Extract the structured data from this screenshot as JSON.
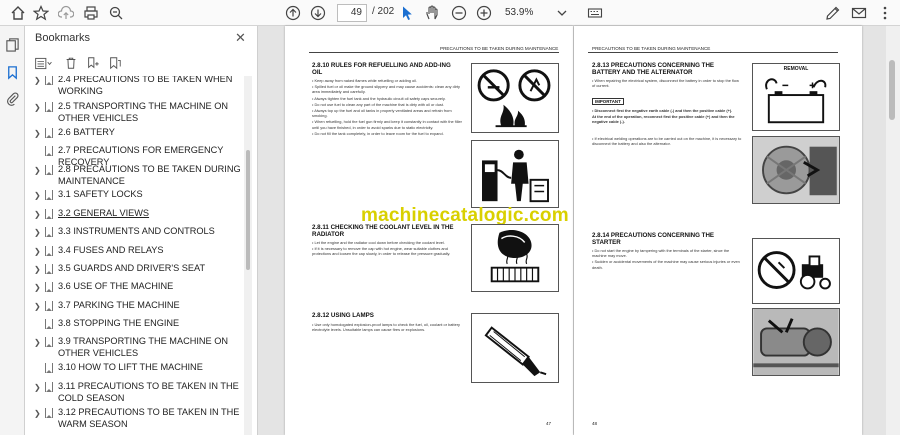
{
  "toolbar": {
    "current_page": "49",
    "total_pages": "/ 202",
    "zoom": "53.9%",
    "icons": [
      "star-icon",
      "cloud-upload-icon",
      "print-icon",
      "zoom-out-search-icon",
      "arrow-up-icon",
      "arrow-down-icon",
      "cursor-icon",
      "hand-icon",
      "minus-icon",
      "plus-icon",
      "chevron-down-icon",
      "sign-icon",
      "email-icon",
      "more-icon"
    ]
  },
  "sidebar": {
    "title": "Bookmarks",
    "close": "✕",
    "items": [
      {
        "label": "2.4 PRECAUTIONS TO BE TAKEN WHEN WORKING",
        "chevron": true
      },
      {
        "label": "2.5 TRANSPORTING THE MACHINE ON OTHER VEHICLES",
        "chevron": true
      },
      {
        "label": "2.6 BATTERY",
        "chevron": true
      },
      {
        "label": "2.7 PRECAUTIONS FOR EMERGENCY RECOVERY",
        "chevron": false
      },
      {
        "label": "2.8 PRECAUTIONS TO BE TAKEN DURING MAINTENANCE",
        "chevron": true
      },
      {
        "label": "3.1 SAFETY LOCKS",
        "chevron": true
      },
      {
        "label": "3.2 GENERAL VIEWS",
        "chevron": true,
        "underline": true
      },
      {
        "label": "3.3 INSTRUMENTS AND CONTROLS",
        "chevron": true
      },
      {
        "label": "3.4 FUSES AND RELAYS",
        "chevron": true
      },
      {
        "label": "3.5 GUARDS AND DRIVER'S SEAT",
        "chevron": true
      },
      {
        "label": "3.6 USE OF THE MACHINE",
        "chevron": true
      },
      {
        "label": "3.7 PARKING THE MACHINE",
        "chevron": true
      },
      {
        "label": "3.8 STOPPING THE ENGINE",
        "chevron": false
      },
      {
        "label": "3.9 TRANSPORTING THE MACHINE ON OTHER VEHICLES",
        "chevron": true
      },
      {
        "label": "3.10 HOW TO LIFT THE MACHINE",
        "chevron": false
      },
      {
        "label": "3.11 PRECAUTIONS TO BE TAKEN IN THE COLD SEASON",
        "chevron": true
      },
      {
        "label": "3.12 PRECAUTIONS TO BE TAKEN IN THE WARM SEASON",
        "chevron": true
      }
    ]
  },
  "doc": {
    "header_left": "PRECAUTIONS TO BE TAKEN DURING MAINTENANCE",
    "header_right": "PRECAUTIONS TO BE TAKEN DURING MAINTENANCE",
    "page_left_num": "47",
    "page_right_num": "48",
    "watermark": "machinecatalogic.com",
    "s1_title": "2.8.10 RULES FOR REFUELLING AND ADD-ING OIL",
    "s1_body": [
      "• Keep away from naked flames while refuelling or adding oil.",
      "• Spilled fuel or oil make the ground slippery and may cause accidents: clean any dirty area immediately and carefully.",
      "• Always tighten the fuel tank and the hydraulic circuit oil safety caps securely.",
      "• Do not use fuel to clean any part of the machine that is dirty with oil or dust.",
      "• Always top up the fuel and oil tanks in properly ventilated areas and refrain from smoking.",
      "• When refuelling, hold the fuel gun firmly and keep it constantly in contact with the filler until you have finished, in order to avoid sparks due to static electricity.",
      "• Do not fill the tank completely, in order to leave room for the fuel to expand."
    ],
    "s2_title": "2.8.11 CHECKING THE COOLANT LEVEL IN THE RADIATOR",
    "s2_body": [
      "• Let the engine and the radiator cool down before checking the coolant level.",
      "• If it is necessary to remove the cap with hot engine, wear suitable clothes and protections and loosen the cap slowly, in order to release the pressure gradually."
    ],
    "s3_title": "2.8.12 USING LAMPS",
    "s3_body": [
      "• Use only homologated explosion-proof lamps to check the fuel, oil, coolant or battery electrolyte levels. Unsuitable lamps can cause fires or explosions."
    ],
    "s4_title": "2.8.13 PRECAUTIONS CONCERNING THE BATTERY AND THE ALTERNATOR",
    "s4_body": [
      "• When repairing the electrical system, disconnect the battery in order to stop the flow of current."
    ],
    "important": "IMPORTANT",
    "s4_important": [
      "• Disconnect first the negative earth cable (-) and then the positive cable (+).",
      "At the end of the operation, reconnect first the positive cable (+) and then the negative cable (-)."
    ],
    "s4_body2": [
      "• If electrical welding operations are to be carried out on the machine, it is necessary to disconnect the battery and also the alternator."
    ],
    "removal": "REMOVAL",
    "s5_title": "2.8.14 PRECAUTIONS CONCERNING THE STARTER",
    "s5_body": [
      "• Do not start the engine by tampering with the terminals of the starter, since the machine may move.",
      "• Sudden or accidental movements of the machine may cause serious injuries or even death."
    ]
  }
}
